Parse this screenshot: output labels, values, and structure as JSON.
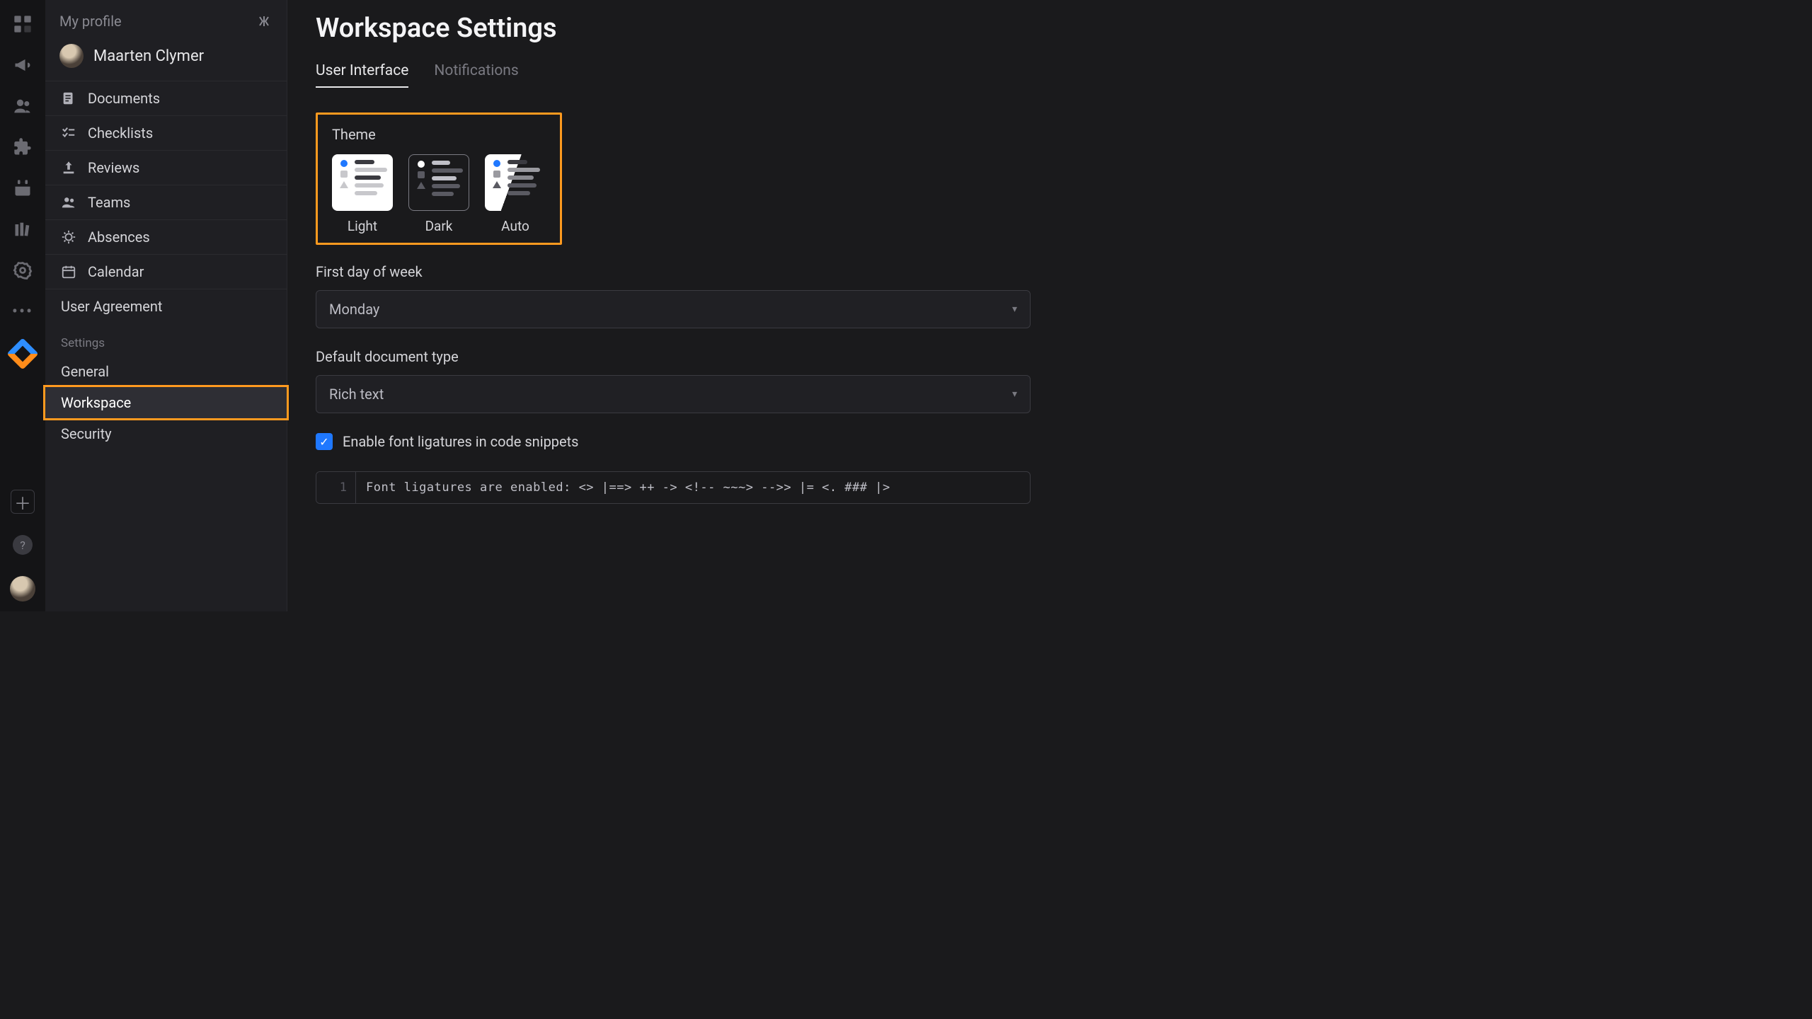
{
  "sidebar_title": "My profile",
  "user_name": "Maarten Clymer",
  "nav_items": [
    {
      "label": "Documents",
      "icon": "documents-icon"
    },
    {
      "label": "Checklists",
      "icon": "checklists-icon"
    },
    {
      "label": "Reviews",
      "icon": "reviews-icon"
    },
    {
      "label": "Teams",
      "icon": "teams-icon"
    },
    {
      "label": "Absences",
      "icon": "absences-icon"
    },
    {
      "label": "Calendar",
      "icon": "calendar-icon"
    }
  ],
  "user_agreement": "User Agreement",
  "settings_label": "Settings",
  "settings_items": [
    {
      "label": "General",
      "active": false
    },
    {
      "label": "Workspace",
      "active": true
    },
    {
      "label": "Security",
      "active": false
    }
  ],
  "page_title": "Workspace Settings",
  "tabs": [
    {
      "label": "User Interface",
      "active": true
    },
    {
      "label": "Notifications",
      "active": false
    }
  ],
  "theme": {
    "label": "Theme",
    "options": [
      {
        "label": "Light",
        "value": "light"
      },
      {
        "label": "Dark",
        "value": "dark",
        "selected": true
      },
      {
        "label": "Auto",
        "value": "auto"
      }
    ]
  },
  "first_day": {
    "label": "First day of week",
    "value": "Monday"
  },
  "doc_type": {
    "label": "Default document type",
    "value": "Rich text"
  },
  "ligatures": {
    "label": "Enable font ligatures in code snippets",
    "checked": true
  },
  "code_sample": {
    "line_number": "1",
    "text": "Font ligatures are enabled: <> |==> ++ -> <!-- ~~~> -->> |= <. ### |>"
  }
}
